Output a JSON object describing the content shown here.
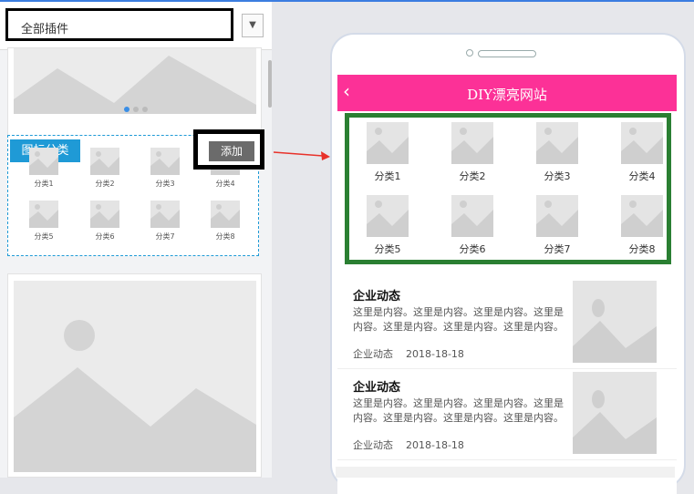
{
  "plugin_select": {
    "value": "全部插件",
    "caret": "▼"
  },
  "icon_category_card": {
    "tag": "图标分类",
    "add_label": "添加",
    "items": [
      "分类1",
      "分类2",
      "分类3",
      "分类4",
      "分类5",
      "分类6",
      "分类7",
      "分类8"
    ]
  },
  "phone": {
    "back_icon": "‹",
    "title": "DIY漂亮网站",
    "categories": [
      "分类1",
      "分类2",
      "分类3",
      "分类4",
      "分类5",
      "分类6",
      "分类7",
      "分类8"
    ],
    "news": [
      {
        "title": "企业动态",
        "body": "这里是内容。这里是内容。这里是内容。这里是内容。这里是内容。这里是内容。这里是内容。这里是内容。",
        "category": "企业动态",
        "date": "2018-18-18"
      },
      {
        "title": "企业动态",
        "body": "这里是内容。这里是内容。这里是内容。这里是内容。这里是内容。这里是内容。这里是内容。这里是内容。",
        "category": "企业动态",
        "date": "2018-18-18"
      }
    ]
  },
  "colors": {
    "accent_blue": "#1f9ad6",
    "appbar_pink": "#fc3197",
    "highlight_green": "#2a7f32",
    "arrow_red": "#e8322a"
  },
  "icons": [
    "image-placeholder-icon",
    "chevron-left-icon",
    "dropdown-caret-icon",
    "arrow-right-icon"
  ]
}
